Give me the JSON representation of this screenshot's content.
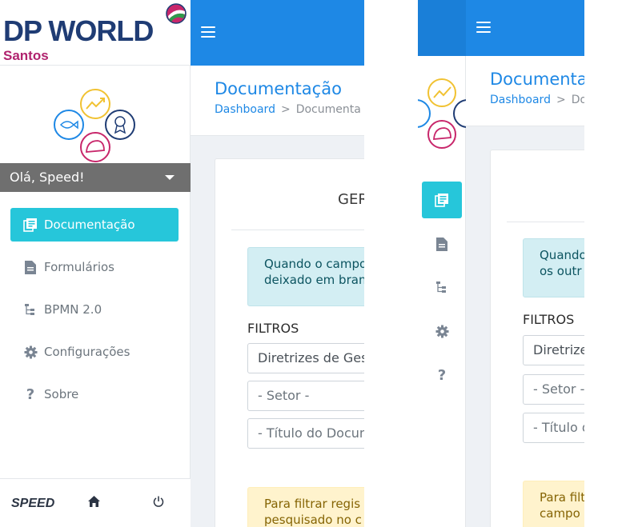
{
  "brand": {
    "name": "DP WORLD",
    "location": "Santos",
    "footer_logo": "SPEED"
  },
  "user": {
    "greeting": "Olá, Speed!"
  },
  "sidebar": {
    "items": [
      {
        "label": "Documentação",
        "icon": "documents-icon",
        "active": true
      },
      {
        "label": "Formulários",
        "icon": "file-icon",
        "active": false
      },
      {
        "label": "BPMN 2.0",
        "icon": "sitemap-icon",
        "active": false
      },
      {
        "label": "Configurações",
        "icon": "gear-icon",
        "active": false
      },
      {
        "label": "Sobre",
        "icon": "question-icon",
        "active": false
      }
    ]
  },
  "page": {
    "title": "Documentação",
    "title_truncated": "Documentaç",
    "breadcrumb": {
      "home": "Dashboard",
      "current": "Documentação",
      "current_truncated_a": "Documenta",
      "current_truncated_b": "Do"
    },
    "card_heading": "GER"
  },
  "alerts": {
    "info_line1": "Quando o campo",
    "info_line2": "deixado em branco",
    "info_line1_b": "Quando",
    "info_line2_b": "os outr",
    "warn_line1": "Para filtrar regis",
    "warn_line2": "pesquisado no c",
    "warn_line1_b": "Para filt",
    "warn_line2_b": "campo"
  },
  "filters": {
    "label": "FILTROS",
    "directive_value": "Diretrizes de Gestão",
    "directive_value_b": "Diretrize",
    "sector_placeholder": "- Setor -",
    "sector_placeholder_b": "- Setor -",
    "title_placeholder": "- Título do Documento",
    "title_placeholder_b": "- Título d"
  },
  "colors": {
    "topbar": "#1e88e5",
    "active_nav": "#26c6da",
    "info_bg": "#d3eef3",
    "warn_bg": "#fff3cd",
    "brand_navy": "#1f3c74",
    "brand_magenta": "#b0226e"
  }
}
